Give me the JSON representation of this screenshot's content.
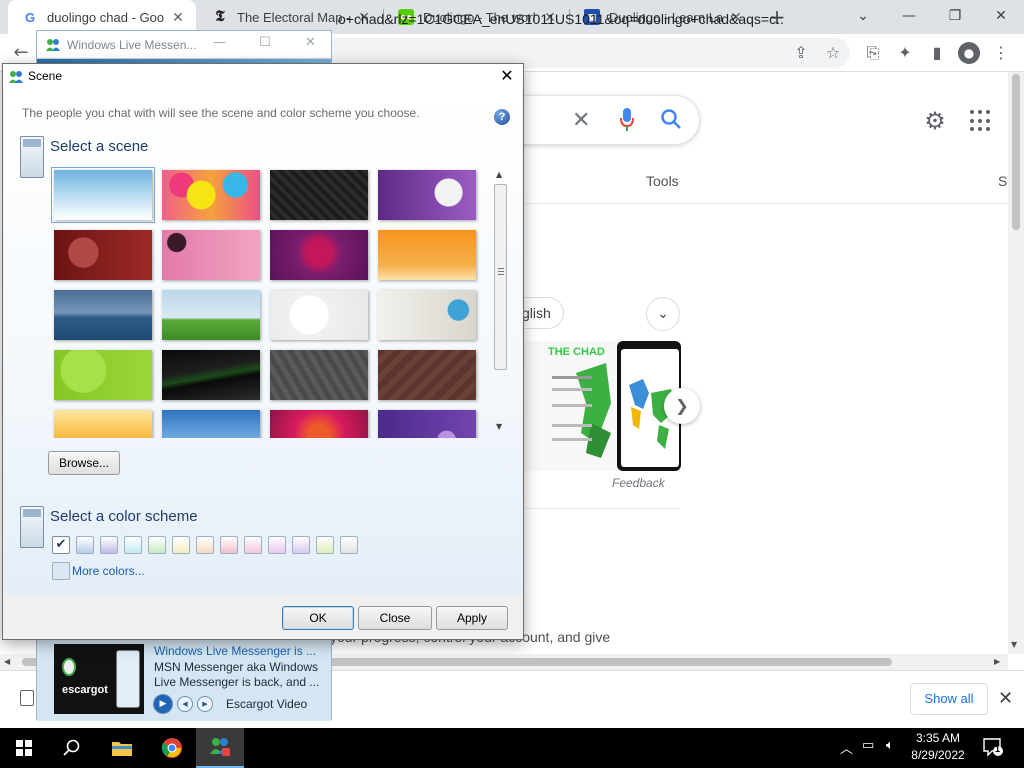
{
  "browser": {
    "tabs": [
      {
        "title": "duolingo chad - Google Search",
        "active": true
      },
      {
        "title": "The Electoral Map - Pre..."
      },
      {
        "title": "Duolingo - The world's..."
      },
      {
        "title": "Duolingo - Learn Lang..."
      }
    ],
    "new_tab": "+",
    "url_fragment": "o+chad&rlz=1C1GCEA_enUS1011US1011&oq=duolingo+chad&aqs=c..."
  },
  "google": {
    "tools_label": "Tools",
    "s_cut": "S",
    "chip_label": "glish",
    "card_title": "THE CHAD",
    "feedback": "Feedback",
    "snippet": "your progress, control your account, and give"
  },
  "download_bar": {
    "show_all": "Show all"
  },
  "messenger": {
    "window_title": "Windows Live Messen...",
    "notification": {
      "title": "Windows Live Messenger is ...",
      "desc1": "MSN Messenger aka Windows",
      "desc2": "Live Messenger is back, and ...",
      "source": "Escargot Video",
      "logo_text": "escargot"
    }
  },
  "scene_dialog": {
    "title": "Scene",
    "intro": "The people you chat with will see the scene and color scheme you choose.",
    "help": "?",
    "select_scene": "Select a scene",
    "browse": "Browse...",
    "select_color": "Select a color scheme",
    "more_colors": "More colors...",
    "ok": "OK",
    "close": "Close",
    "apply": "Apply",
    "scenes": [
      {
        "name": "sky-blue",
        "bg": "linear-gradient(180deg,#6fb3de 0%,#bfe0f4 55%,#ffffff 100%)",
        "selected": true
      },
      {
        "name": "colorful-swirls",
        "bg": "radial-gradient(circle at 40% 50%,#f6e514 0 22%,transparent 23%),radial-gradient(circle at 75% 30%,#38b6e8 0 15%,transparent 16%),radial-gradient(circle at 20% 30%,#ee3a7a 0 14%,transparent 15%),linear-gradient(90deg,#f25e8a,#f4a23c,#ec4f86)"
      },
      {
        "name": "dark-pattern",
        "bg": "repeating-linear-gradient(45deg,#1c1c1c 0 4px,#2c2c2c 4px 8px)"
      },
      {
        "name": "skull-purple",
        "bg": "radial-gradient(circle at 72% 45%,#f2f2f2 0 18%,transparent 19%),linear-gradient(90deg,#5e2a86,#9b5cc4)"
      },
      {
        "name": "love-red",
        "bg": "radial-gradient(circle at 30% 45%,#b24845 0 20%,transparent 21%),linear-gradient(90deg,#6b1414,#9e2a28)"
      },
      {
        "name": "pink-dots",
        "bg": "radial-gradient(circle at 15% 25%,#3a1a2a 0 10%,transparent 11%),linear-gradient(90deg,#e27aa7,#f2a4c3)"
      },
      {
        "name": "magenta-flower",
        "bg": "radial-gradient(circle at 50% 45%,#c2185b 0 22%,#7a1d6e 40%,#5a1358 100%)"
      },
      {
        "name": "orange-grass",
        "bg": "linear-gradient(180deg,#f7931e,#f6b04c 70%,#fbe1a8)"
      },
      {
        "name": "sea-plane",
        "bg": "linear-gradient(180deg,#4a6f93 0%,#7597b8 45%,#2f5c86 55%,#1e4b73 100%)"
      },
      {
        "name": "green-field",
        "bg": "linear-gradient(180deg,#bcd7ea 0%,#d8e9f4 55%,#5bab3a 60%,#3d8c26 100%)"
      },
      {
        "name": "white-floral",
        "bg": "radial-gradient(circle at 40% 50%,#ffffff 0 30%,#f0f0f0 31%,#e8e8e8 100%)"
      },
      {
        "name": "chameleon",
        "bg": "radial-gradient(circle at 82% 40%,#3fa3d8 0 12%,transparent 13%),linear-gradient(90deg,#f2f1ec,#d8d5cc)"
      },
      {
        "name": "lime-green",
        "bg": "radial-gradient(circle at 30% 40%,#a8e04a 0 30%,transparent 31%),linear-gradient(90deg,#86c626,#9bd63a)"
      },
      {
        "name": "black-green",
        "bg": "linear-gradient(170deg,#0a0a0a 0%,#1e1e1e 40%,#1c4a1a 52%,#0a0a0a 60%,#2c2c2c 100%)"
      },
      {
        "name": "gray-hex",
        "bg": "repeating-linear-gradient(60deg,#4a4a4a 0 5px,#5a5a5a 5px 10px)"
      },
      {
        "name": "brown-pattern",
        "bg": "repeating-linear-gradient(135deg,#5b352e 0 6px,#6d4037 6px 12px)"
      },
      {
        "name": "autumn-tree",
        "bg": "linear-gradient(180deg,#fbe7a1 0%,#f9c24b 45%,#e58d18 100%)"
      },
      {
        "name": "blue-mountains",
        "bg": "linear-gradient(180deg,#2e73c2 0%,#6fa8de 55%,#b6d4ef 100%)"
      },
      {
        "name": "pink-burst",
        "bg": "radial-gradient(circle at 50% 50%,#f05a28 0 18%,#d81b60 45%,#8e1445 100%)"
      },
      {
        "name": "purple-swirl",
        "bg": "radial-gradient(circle at 70% 60%,#b993e0 0 12%,transparent 13%),linear-gradient(90deg,#4a2a8a,#7344b0)"
      }
    ],
    "color_schemes": [
      {
        "name": "default-check",
        "color": "#ffffff",
        "checked": true
      },
      {
        "name": "blue",
        "color": "#b9cdea"
      },
      {
        "name": "violet",
        "color": "#c4b9ea"
      },
      {
        "name": "cyan",
        "color": "#c2ecf0"
      },
      {
        "name": "green",
        "color": "#c6ecc2"
      },
      {
        "name": "yellow",
        "color": "#f2eec0"
      },
      {
        "name": "peach",
        "color": "#f6d8c0"
      },
      {
        "name": "rose",
        "color": "#f2c0c8"
      },
      {
        "name": "pink",
        "color": "#f4c4dd"
      },
      {
        "name": "magenta",
        "color": "#ecc6ee"
      },
      {
        "name": "lavender",
        "color": "#d8c8f0"
      },
      {
        "name": "lime",
        "color": "#dcefb8"
      },
      {
        "name": "gray",
        "color": "#e2e2e2"
      }
    ]
  },
  "taskbar": {
    "clock_time": "3:35 AM",
    "clock_date": "8/29/2022",
    "notification_count": "1"
  }
}
